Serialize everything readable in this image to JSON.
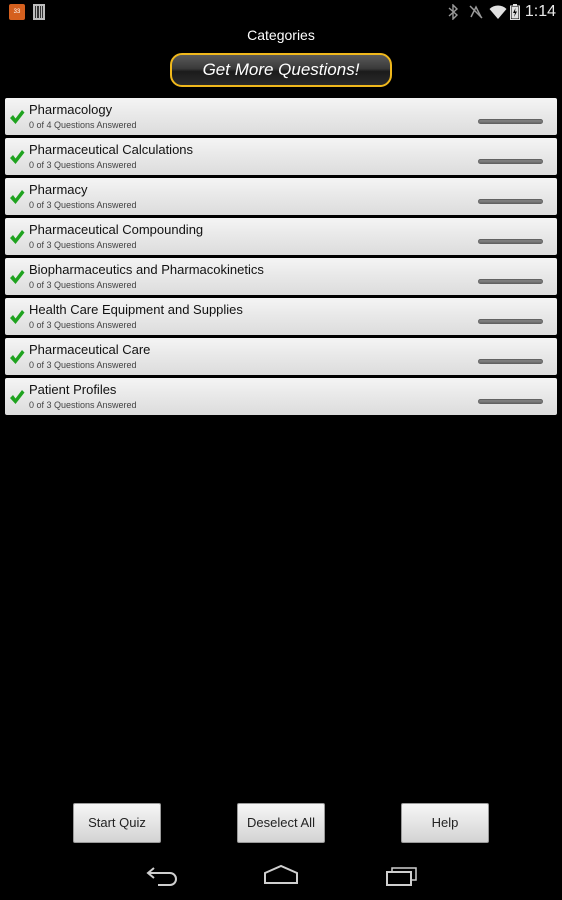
{
  "status_bar": {
    "notification_app_label": "33",
    "time": "1:14",
    "icons": [
      "app-notification-icon",
      "barcode-icon",
      "bluetooth-icon",
      "no-signal-icon",
      "wifi-icon",
      "battery-icon"
    ]
  },
  "header": {
    "title": "Categories",
    "promo_button_label": "Get More Questions!"
  },
  "categories": [
    {
      "name": "Pharmacology",
      "progress_text": "0 of 4 Questions Answered",
      "answered": 0,
      "total": 4,
      "selected": true
    },
    {
      "name": "Pharmaceutical Calculations",
      "progress_text": "0 of 3 Questions Answered",
      "answered": 0,
      "total": 3,
      "selected": true
    },
    {
      "name": "Pharmacy",
      "progress_text": "0 of 3 Questions Answered",
      "answered": 0,
      "total": 3,
      "selected": true
    },
    {
      "name": "Pharmaceutical Compounding",
      "progress_text": "0 of 3 Questions Answered",
      "answered": 0,
      "total": 3,
      "selected": true
    },
    {
      "name": "Biopharmaceutics and Pharmacokinetics",
      "progress_text": "0 of 3 Questions Answered",
      "answered": 0,
      "total": 3,
      "selected": true
    },
    {
      "name": "Health Care Equipment and Supplies",
      "progress_text": "0 of 3 Questions Answered",
      "answered": 0,
      "total": 3,
      "selected": true
    },
    {
      "name": "Pharmaceutical Care",
      "progress_text": "0 of 3 Questions Answered",
      "answered": 0,
      "total": 3,
      "selected": true
    },
    {
      "name": "Patient Profiles",
      "progress_text": "0 of 3 Questions Answered",
      "answered": 0,
      "total": 3,
      "selected": true
    }
  ],
  "buttons": {
    "start_quiz": "Start Quiz",
    "deselect_all": "Deselect All",
    "help": "Help"
  },
  "nav_bar": {
    "icons": [
      "back-icon",
      "home-icon",
      "recent-apps-icon"
    ]
  },
  "colors": {
    "background": "#000000",
    "promo_border": "#f0b81c",
    "check": "#1fa31f",
    "list_item_bg": "#e8e8e8"
  }
}
